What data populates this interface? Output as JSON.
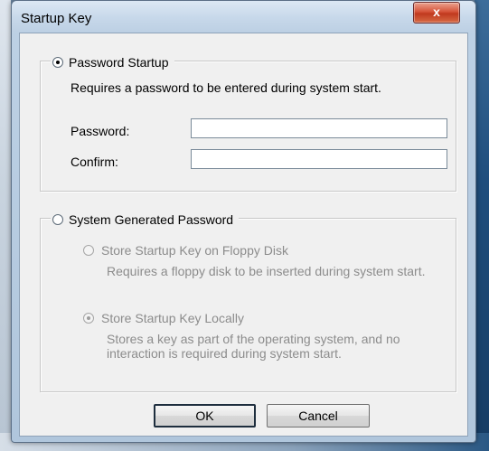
{
  "window": {
    "title": "Startup Key",
    "close_glyph": "x"
  },
  "password_group": {
    "option_label": "Password Startup",
    "selected": true,
    "description": "Requires a password to be entered during system start.",
    "password_label": "Password:",
    "password_value": "",
    "confirm_label": "Confirm:",
    "confirm_value": ""
  },
  "system_group": {
    "option_label": "System Generated Password",
    "selected": false,
    "floppy": {
      "label": "Store Startup Key on Floppy Disk",
      "description": "Requires a floppy disk to be inserted during system start.",
      "selected": false,
      "enabled": false
    },
    "local": {
      "label": "Store Startup Key Locally",
      "description": "Stores a key as part of the operating system, and no interaction is required during system start.",
      "selected": true,
      "enabled": false
    }
  },
  "buttons": {
    "ok_label": "OK",
    "cancel_label": "Cancel"
  },
  "colors": {
    "close_button": "#c7472a",
    "dialog_background": "#f0f0f0",
    "disabled_text": "#8c8c8c"
  }
}
